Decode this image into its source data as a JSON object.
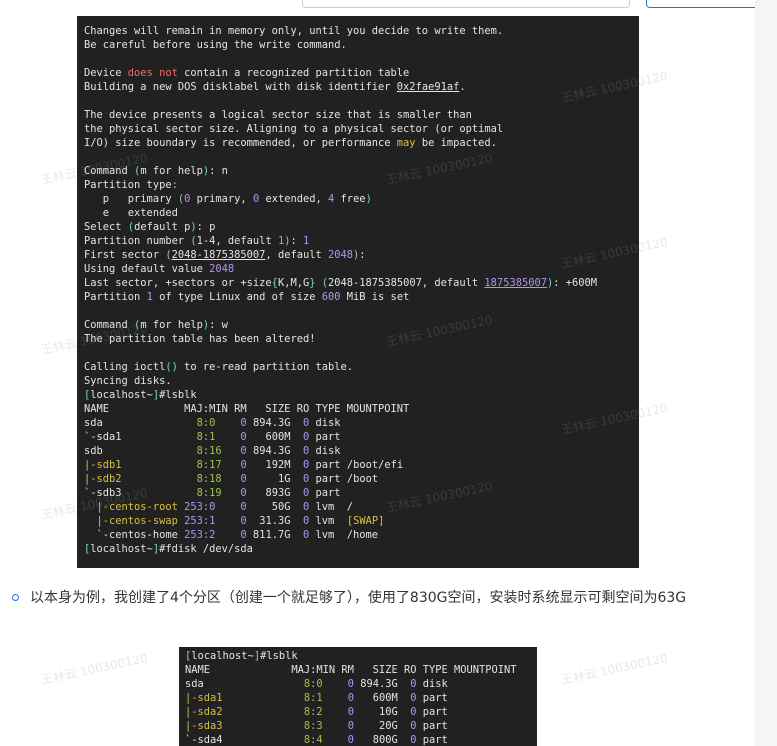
{
  "terminal1": {
    "lines": [
      [
        {
          "t": "Changes will remain in memory only, until you decide to write them."
        }
      ],
      [
        {
          "t": "Be careful before using the write command."
        }
      ],
      [
        {
          "t": ""
        }
      ],
      [
        {
          "t": "Device "
        },
        {
          "t": "does not",
          "c": "red"
        },
        {
          "t": " contain a recognized partition table"
        }
      ],
      [
        {
          "t": "Building a new DOS disklabel with disk identifier "
        },
        {
          "t": "0x2fae91af",
          "c": "ul"
        },
        {
          "t": "."
        }
      ],
      [
        {
          "t": ""
        }
      ],
      [
        {
          "t": "The device presents a logical sector size that is smaller than"
        }
      ],
      [
        {
          "t": "the physical sector size. Aligning to a physical sector (or optimal"
        }
      ],
      [
        {
          "t": "I/O) size boundary is recommended, or performance "
        },
        {
          "t": "may",
          "c": "ye"
        },
        {
          "t": " be impacted."
        }
      ],
      [
        {
          "t": ""
        }
      ],
      [
        {
          "t": "Command "
        },
        {
          "t": "(",
          "c": "cy"
        },
        {
          "t": "m for help"
        },
        {
          "t": ")",
          "c": "cy"
        },
        {
          "t": ": n"
        }
      ],
      [
        {
          "t": "Partition type"
        },
        {
          "t": ":",
          "c": "cy"
        }
      ],
      [
        {
          "t": "   p   primary "
        },
        {
          "t": "(",
          "c": "cy"
        },
        {
          "t": "0",
          "c": "pu"
        },
        {
          "t": " primary, "
        },
        {
          "t": "0",
          "c": "pu"
        },
        {
          "t": " extended, "
        },
        {
          "t": "4",
          "c": "pu"
        },
        {
          "t": " free"
        },
        {
          "t": ")",
          "c": "cy"
        }
      ],
      [
        {
          "t": "   e   extended"
        }
      ],
      [
        {
          "t": "Select "
        },
        {
          "t": "(",
          "c": "cy"
        },
        {
          "t": "default p"
        },
        {
          "t": ")",
          "c": "cy"
        },
        {
          "t": ": p"
        }
      ],
      [
        {
          "t": "Partition number "
        },
        {
          "t": "(",
          "c": "cy"
        },
        {
          "t": "1-4, default "
        },
        {
          "t": "1",
          "c": "pu"
        },
        {
          "t": ")",
          "c": "cy"
        },
        {
          "t": ": "
        },
        {
          "t": "1",
          "c": "pu"
        }
      ],
      [
        {
          "t": "First sector "
        },
        {
          "t": "(",
          "c": "cy"
        },
        {
          "t": "2048-1875385007",
          "c": "ul"
        },
        {
          "t": ", default "
        },
        {
          "t": "2048",
          "c": "pu"
        },
        {
          "t": ")",
          "c": "cy"
        },
        {
          "t": ":"
        }
      ],
      [
        {
          "t": "Using default value "
        },
        {
          "t": "2048",
          "c": "pu"
        }
      ],
      [
        {
          "t": "Last sector, +sectors or +size"
        },
        {
          "t": "{",
          "c": "cy"
        },
        {
          "t": "K,M,G"
        },
        {
          "t": "}",
          "c": "cy"
        },
        {
          "t": " "
        },
        {
          "t": "(",
          "c": "cy"
        },
        {
          "t": "2048-1875385007, default "
        },
        {
          "t": "1875385007",
          "c": "pu ul"
        },
        {
          "t": ")",
          "c": "cy"
        },
        {
          "t": ": +600M"
        }
      ],
      [
        {
          "t": "Partition "
        },
        {
          "t": "1",
          "c": "pu"
        },
        {
          "t": " of type Linux and of size "
        },
        {
          "t": "600",
          "c": "pu"
        },
        {
          "t": " MiB is set"
        }
      ],
      [
        {
          "t": ""
        }
      ],
      [
        {
          "t": "Command "
        },
        {
          "t": "(",
          "c": "cy"
        },
        {
          "t": "m for help"
        },
        {
          "t": ")",
          "c": "cy"
        },
        {
          "t": ": w"
        }
      ],
      [
        {
          "t": "The partition table has been altered!"
        }
      ],
      [
        {
          "t": ""
        }
      ],
      [
        {
          "t": "Calling ioctl"
        },
        {
          "t": "()",
          "c": "cy"
        },
        {
          "t": " to re-read partition table."
        }
      ],
      [
        {
          "t": "Syncing disks."
        }
      ],
      [
        {
          "t": "[",
          "c": "cy"
        },
        {
          "t": "localhost~"
        },
        {
          "t": "]",
          "c": "cy"
        },
        {
          "t": "#lsblk"
        }
      ],
      [
        {
          "t": "NAME            MAJ:MIN RM   SIZE RO TYPE MOUNTPOINT"
        }
      ],
      [
        {
          "t": "sda               "
        },
        {
          "t": "8:0",
          "c": "gr"
        },
        {
          "t": "    "
        },
        {
          "t": "0",
          "c": "pu"
        },
        {
          "t": " 894.3G  "
        },
        {
          "t": "0",
          "c": "pu"
        },
        {
          "t": " disk"
        }
      ],
      [
        {
          "t": "`-sda1            "
        },
        {
          "t": "8:1",
          "c": "gr"
        },
        {
          "t": "    "
        },
        {
          "t": "0",
          "c": "pu"
        },
        {
          "t": "   600M  "
        },
        {
          "t": "0",
          "c": "pu"
        },
        {
          "t": " part"
        }
      ],
      [
        {
          "t": "sdb               "
        },
        {
          "t": "8:16",
          "c": "gr"
        },
        {
          "t": "   "
        },
        {
          "t": "0",
          "c": "pu"
        },
        {
          "t": " 894.3G  "
        },
        {
          "t": "0",
          "c": "pu"
        },
        {
          "t": " disk"
        }
      ],
      [
        {
          "t": "|-sdb1",
          "c": "ye"
        },
        {
          "t": "            "
        },
        {
          "t": "8:17",
          "c": "gr"
        },
        {
          "t": "   "
        },
        {
          "t": "0",
          "c": "pu"
        },
        {
          "t": "   192M  "
        },
        {
          "t": "0",
          "c": "pu"
        },
        {
          "t": " part /boot/efi"
        }
      ],
      [
        {
          "t": "|-sdb2",
          "c": "ye"
        },
        {
          "t": "            "
        },
        {
          "t": "8:18",
          "c": "gr"
        },
        {
          "t": "   "
        },
        {
          "t": "0",
          "c": "pu"
        },
        {
          "t": "     1G  "
        },
        {
          "t": "0",
          "c": "pu"
        },
        {
          "t": " part /boot"
        }
      ],
      [
        {
          "t": "`-sdb3            "
        },
        {
          "t": "8:19",
          "c": "gr"
        },
        {
          "t": "   "
        },
        {
          "t": "0",
          "c": "pu"
        },
        {
          "t": "   893G  "
        },
        {
          "t": "0",
          "c": "pu"
        },
        {
          "t": " part"
        }
      ],
      [
        {
          "t": "  "
        },
        {
          "t": "|-centos-root",
          "c": "ye"
        },
        {
          "t": " "
        },
        {
          "t": "253:0",
          "c": "pu"
        },
        {
          "t": "    "
        },
        {
          "t": "0",
          "c": "pu"
        },
        {
          "t": "    50G  "
        },
        {
          "t": "0",
          "c": "pu"
        },
        {
          "t": " lvm  /"
        }
      ],
      [
        {
          "t": "  "
        },
        {
          "t": "|-centos-swap",
          "c": "ye"
        },
        {
          "t": " "
        },
        {
          "t": "253:1",
          "c": "pu"
        },
        {
          "t": "    "
        },
        {
          "t": "0",
          "c": "pu"
        },
        {
          "t": "  31.3G  "
        },
        {
          "t": "0",
          "c": "pu"
        },
        {
          "t": " lvm  "
        },
        {
          "t": "[SWAP]",
          "c": "ye"
        }
      ],
      [
        {
          "t": "  `-centos-home "
        },
        {
          "t": "253:2",
          "c": "pu"
        },
        {
          "t": "    "
        },
        {
          "t": "0",
          "c": "pu"
        },
        {
          "t": " 811.7G  "
        },
        {
          "t": "0",
          "c": "pu"
        },
        {
          "t": " lvm  /home"
        }
      ],
      [
        {
          "t": "[",
          "c": "cy"
        },
        {
          "t": "localhost~"
        },
        {
          "t": "]",
          "c": "cy"
        },
        {
          "t": "#fdisk /dev/sda"
        }
      ]
    ]
  },
  "bullet": {
    "text": "以本身为例，我创建了4个分区（创建一个就足够了），使用了830G空间，安装时系统显示可剩空间为63G"
  },
  "terminal2": {
    "lines": [
      [
        {
          "t": "[",
          "c": "cy"
        },
        {
          "t": "localhost~"
        },
        {
          "t": "]",
          "c": "cy"
        },
        {
          "t": "#lsblk"
        }
      ],
      [
        {
          "t": "NAME             MAJ:MIN RM   SIZE RO TYPE MOUNTPOINT"
        }
      ],
      [
        {
          "t": "sda                "
        },
        {
          "t": "8:0",
          "c": "gr"
        },
        {
          "t": "    "
        },
        {
          "t": "0",
          "c": "pu"
        },
        {
          "t": " 894.3G  "
        },
        {
          "t": "0",
          "c": "pu"
        },
        {
          "t": " disk"
        }
      ],
      [
        {
          "t": "|-sda1",
          "c": "ye"
        },
        {
          "t": "             "
        },
        {
          "t": "8:1",
          "c": "gr"
        },
        {
          "t": "    "
        },
        {
          "t": "0",
          "c": "pu"
        },
        {
          "t": "   600M  "
        },
        {
          "t": "0",
          "c": "pu"
        },
        {
          "t": " part"
        }
      ],
      [
        {
          "t": "|-sda2",
          "c": "ye"
        },
        {
          "t": "             "
        },
        {
          "t": "8:2",
          "c": "gr"
        },
        {
          "t": "    "
        },
        {
          "t": "0",
          "c": "pu"
        },
        {
          "t": "    10G  "
        },
        {
          "t": "0",
          "c": "pu"
        },
        {
          "t": " part"
        }
      ],
      [
        {
          "t": "|-sda3",
          "c": "ye"
        },
        {
          "t": "             "
        },
        {
          "t": "8:3",
          "c": "gr"
        },
        {
          "t": "    "
        },
        {
          "t": "0",
          "c": "pu"
        },
        {
          "t": "    20G  "
        },
        {
          "t": "0",
          "c": "pu"
        },
        {
          "t": " part"
        }
      ],
      [
        {
          "t": "`-sda4             "
        },
        {
          "t": "8:4",
          "c": "gr"
        },
        {
          "t": "    "
        },
        {
          "t": "0",
          "c": "pu"
        },
        {
          "t": "   800G  "
        },
        {
          "t": "0",
          "c": "pu"
        },
        {
          "t": " part"
        }
      ]
    ]
  },
  "watermark": {
    "text": "王林云 100300120"
  },
  "colors": {
    "accent": "#2a6fd6",
    "terminal_bg": "#212121"
  }
}
